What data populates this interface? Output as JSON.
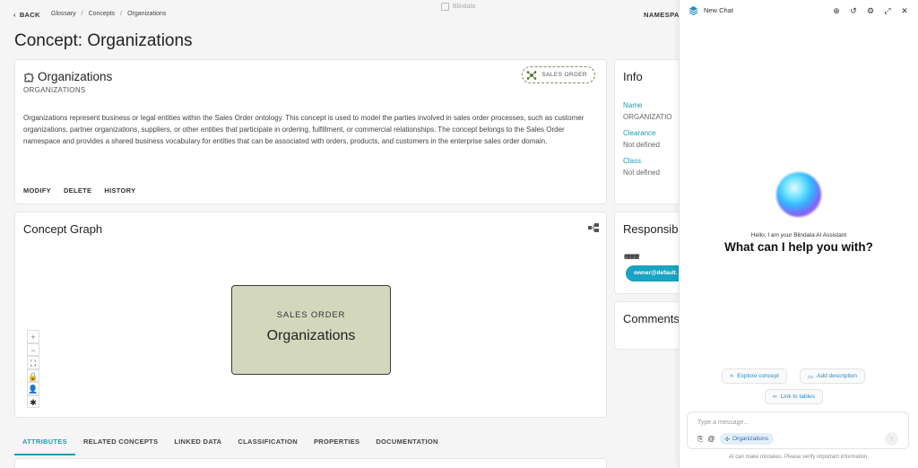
{
  "topbar": {
    "back_label": "BACK",
    "breadcrumbs": [
      "Glossary",
      "Concepts",
      "Organizations"
    ],
    "brand": "Blindata",
    "namespace_label": "NAMESPA"
  },
  "page": {
    "title": "Concept: Organizations"
  },
  "concept": {
    "name": "Organizations",
    "code": "ORGANIZATIONS",
    "namespace_chip": "SALES ORDER",
    "description": "Organizations represent business or legal entities within the Sales Order ontology. This concept is used to model the parties involved in sales order processes, such as customer organizations, partner organizations, suppliers, or other entities that participate in ordering, fulfillment, or commercial relationships. The concept belongs to the Sales Order namespace and provides a shared business vocabulary for entities that can be associated with orders, products, and customers in the enterprise sales order domain.",
    "actions": [
      "MODIFY",
      "DELETE",
      "HISTORY"
    ]
  },
  "info": {
    "title": "Info",
    "fields": [
      {
        "label": "Name",
        "value": "ORGANIZATIO"
      },
      {
        "label": "Clearance",
        "value": "Not defined"
      },
      {
        "label": "Class",
        "value": "Not defined"
      }
    ]
  },
  "graph": {
    "title": "Concept Graph",
    "node_namespace": "SALES ORDER",
    "node_name": "Organizations",
    "tools": [
      "+",
      "−",
      "⛶",
      "🔒",
      "👤",
      "✱"
    ]
  },
  "responsibilities": {
    "title": "Responsib",
    "filler": "ffffffffffffffffffff",
    "owner_chip": "owner@default."
  },
  "comments": {
    "title": "Comments"
  },
  "tabs": [
    "ATTRIBUTES",
    "RELATED CONCEPTS",
    "LINKED DATA",
    "CLASSIFICATION",
    "PROPERTIES",
    "DOCUMENTATION"
  ],
  "chat": {
    "title": "New Chat",
    "hello": "Hello, I am your Blindata AI Assistant",
    "headline": "What can I help you with?",
    "suggestions": [
      "Explore concept",
      "Add description",
      "Link to tables"
    ],
    "input_placeholder": "Type a message...",
    "context_chip": "Organizations",
    "disclaimer": "AI can make mistakes. Please verify important information."
  },
  "colors": {
    "accent": "#1f9ab5",
    "node_fill": "#d3d8bd",
    "owner_chip": "#1aa3c2"
  }
}
